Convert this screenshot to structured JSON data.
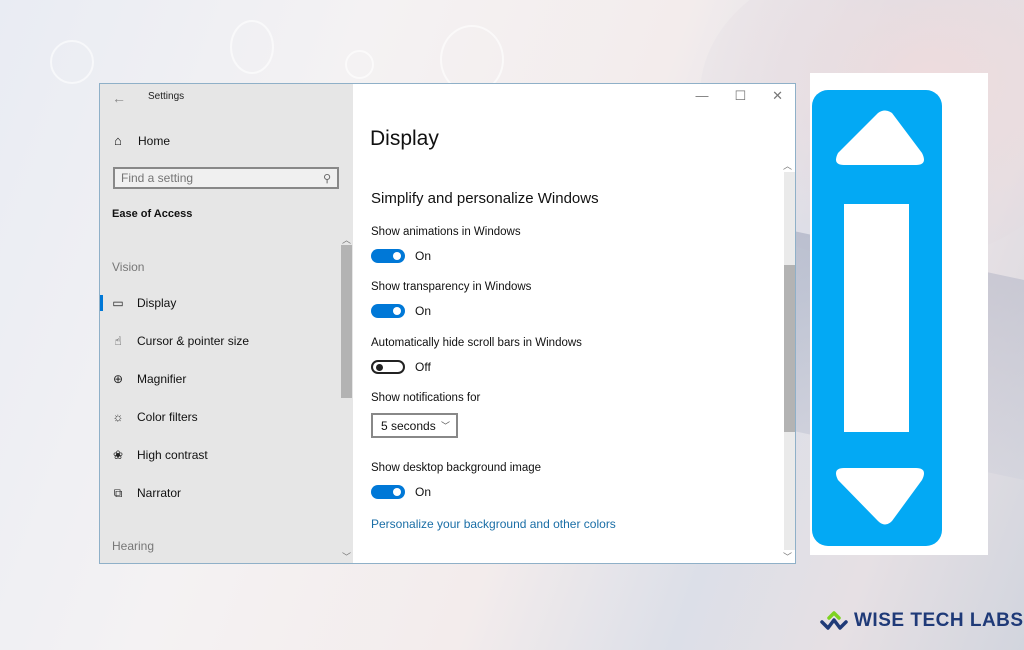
{
  "window": {
    "title": "Settings",
    "controls": {
      "minimize": "—",
      "maximize": "☐",
      "close": "✕"
    }
  },
  "sidebar": {
    "home_label": "Home",
    "search": {
      "placeholder": "Find a setting",
      "value": ""
    },
    "section_title": "Ease of Access",
    "groups": [
      {
        "label": "Vision"
      },
      {
        "label": "Hearing"
      }
    ],
    "items": [
      {
        "label": "Display",
        "icon": "monitor-icon",
        "active": true
      },
      {
        "label": "Cursor & pointer size",
        "icon": "cursor-icon",
        "active": false
      },
      {
        "label": "Magnifier",
        "icon": "magnifier-icon",
        "active": false
      },
      {
        "label": "Color filters",
        "icon": "sun-icon",
        "active": false
      },
      {
        "label": "High contrast",
        "icon": "palette-icon",
        "active": false
      },
      {
        "label": "Narrator",
        "icon": "narrator-icon",
        "active": false
      }
    ]
  },
  "content": {
    "page_title": "Display",
    "subheading": "Simplify and personalize Windows",
    "settings": [
      {
        "label": "Show animations in Windows",
        "type": "toggle",
        "state": "On"
      },
      {
        "label": "Show transparency in Windows",
        "type": "toggle",
        "state": "On"
      },
      {
        "label": "Automatically hide scroll bars in Windows",
        "type": "toggle",
        "state": "Off"
      },
      {
        "label": "Show notifications for",
        "type": "dropdown",
        "value": "5 seconds"
      },
      {
        "label": "Show desktop background image",
        "type": "toggle",
        "state": "On"
      }
    ],
    "link": "Personalize your background and other colors"
  },
  "graphic": {
    "name": "scrollbar-illustration",
    "color": "#03a9f4"
  },
  "brand": {
    "text": "WISE TECH LABS",
    "colors": {
      "primary": "#1f3a78",
      "accent": "#7ed321"
    }
  },
  "colors": {
    "accent": "#0078d7",
    "link": "#1a6ea6",
    "sidebar_bg": "#e6e6e6"
  }
}
